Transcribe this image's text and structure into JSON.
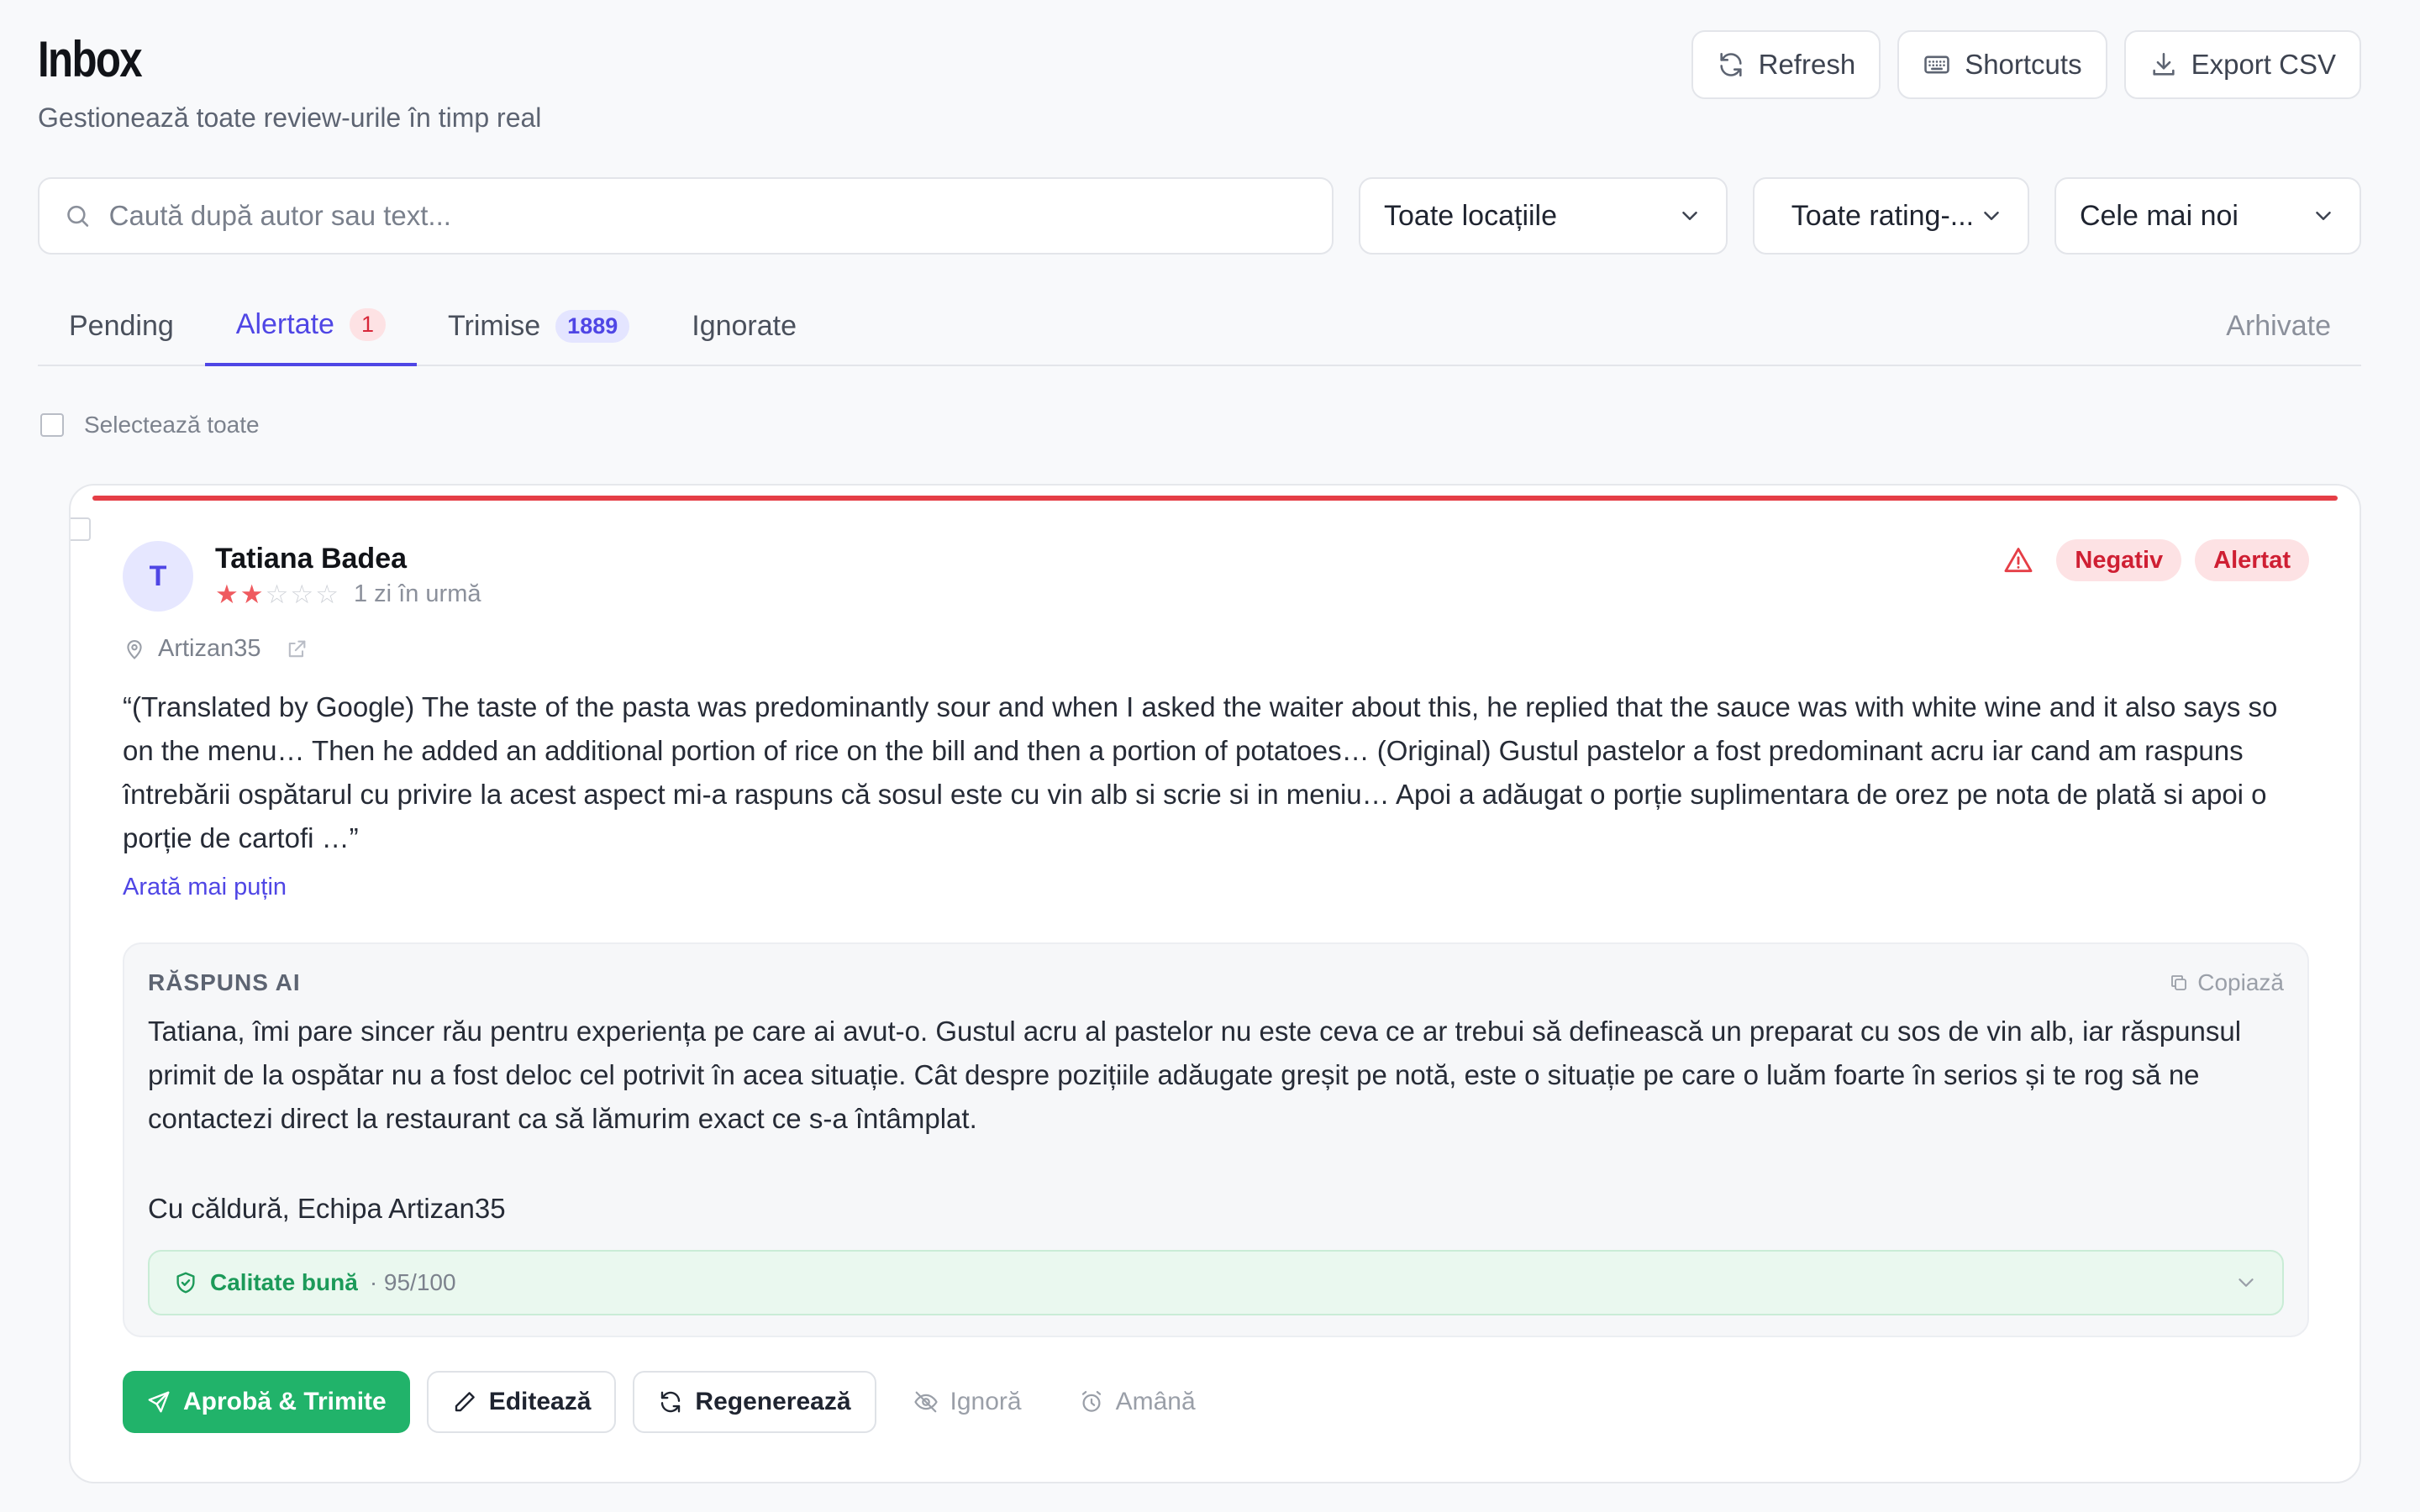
{
  "header": {
    "title": "Inbox",
    "subtitle": "Gestionează toate review-urile în timp real",
    "actions": {
      "refresh": "Refresh",
      "shortcuts": "Shortcuts",
      "export": "Export CSV"
    }
  },
  "filters": {
    "search_placeholder": "Caută după autor sau text...",
    "location": "Toate locațiile",
    "rating": "Toate rating-...",
    "sort": "Cele mai noi"
  },
  "tabs": {
    "pending": {
      "label": "Pending"
    },
    "alerted": {
      "label": "Alertate",
      "count": "1"
    },
    "sent": {
      "label": "Trimise",
      "count": "1889"
    },
    "ignored": {
      "label": "Ignorate"
    },
    "archived": {
      "label": "Arhivate"
    }
  },
  "select_all": "Selectează toate",
  "review": {
    "avatar_initial": "T",
    "author": "Tatiana Badea",
    "rating": 2,
    "rating_max": 5,
    "time": "1 zi în urmă",
    "location": "Artizan35",
    "flags": {
      "sentiment": "Negativ",
      "status": "Alertat"
    },
    "text": "“(Translated by Google) The taste of the pasta was predominantly sour and when I asked the waiter about this, he replied that the sauce was with white wine and it also says so on the menu… Then he added an additional portion of rice on the bill and then a portion of potatoes… (Original) Gustul pastelor a fost predominant acru iar cand am raspuns întrebării ospătarul cu privire la acest aspect mi-a raspuns că sosul este cu vin alb si scrie si in meniu… Apoi a adăugat o porție suplimentara de orez pe nota de plată si apoi o porție de cartofi …”",
    "toggle": "Arată mai puțin"
  },
  "ai_response": {
    "label": "RĂSPUNS AI",
    "copy": "Copiază",
    "text": "Tatiana, îmi pare sincer rău pentru experiența pe care ai avut-o. Gustul acru al pastelor nu este ceva ce ar trebui să definească un preparat cu sos de vin alb, iar răspunsul primit de la ospătar nu a fost deloc cel potrivit în acea situație. Cât despre pozițiile adăugate greșit pe notă, este o situație pe care o luăm foarte în serios și te rog să ne contactezi direct la restaurant ca să lămurim exact ce s-a întâmplat.",
    "signature": "Cu căldură, Echipa Artizan35",
    "quality_label": "Calitate bună",
    "quality_score": "· 95/100"
  },
  "card_actions": {
    "approve": "Aprobă & Trimite",
    "edit": "Editează",
    "regenerate": "Regenerează",
    "ignore": "Ignoră",
    "postpone": "Amână"
  },
  "colors": {
    "accent": "#4f46e5",
    "danger": "#e53e46",
    "success": "#21b36a"
  },
  "icons": [
    "refresh-icon",
    "keyboard-icon",
    "download-icon",
    "search-icon",
    "chevron-down-icon",
    "warning-icon",
    "map-pin-icon",
    "external-link-icon",
    "copy-icon",
    "shield-check-icon",
    "send-icon",
    "pencil-icon",
    "eye-off-icon",
    "alarm-clock-icon"
  ]
}
